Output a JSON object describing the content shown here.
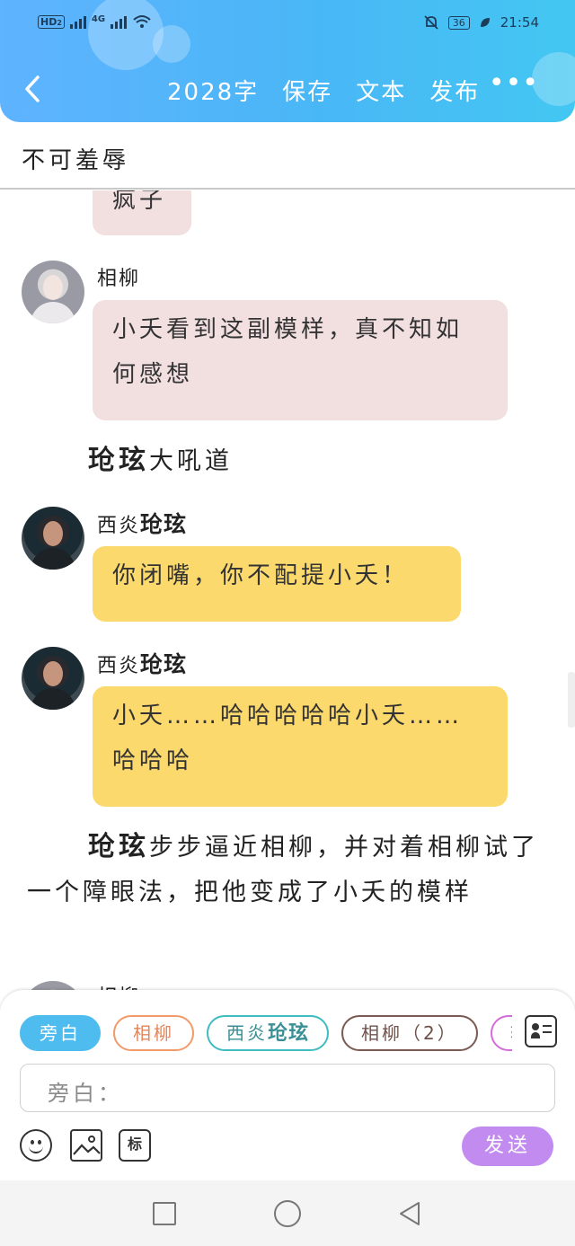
{
  "status_bar": {
    "hd": "HD",
    "hd_sub": "2",
    "network": "4G",
    "battery": "36",
    "time": "21:54"
  },
  "header": {
    "word_count": "2028字",
    "save": "保存",
    "text": "文本",
    "publish": "发布",
    "more": "•••"
  },
  "title": "不可羞辱",
  "chat": {
    "partial_top": "疯子",
    "messages": [
      {
        "speaker": "相柳",
        "text": "小夭看到这副模样，真不知如何感想",
        "color": "pink"
      },
      {
        "narration_bold": "玱玹",
        "narration_rest": "大吼道"
      },
      {
        "speaker_prefix": "西炎",
        "speaker_bold": "玱玹",
        "text": "你闭嘴，你不配提小夭！",
        "color": "yellow"
      },
      {
        "speaker_prefix": "西炎",
        "speaker_bold": "玱玹",
        "text": "小夭……哈哈哈哈哈小夭……哈哈哈",
        "color": "yellow"
      },
      {
        "narration_bold": "玱玹",
        "narration_rest": "步步逼近相柳，并对着相柳试了一个障眼法，把他变成了小夭的模样"
      },
      {
        "speaker": "相柳"
      }
    ]
  },
  "roles": {
    "chips": [
      {
        "label": "旁白"
      },
      {
        "label": "相柳"
      },
      {
        "prefix": "西炎",
        "bold": "玱玹"
      },
      {
        "label": "相柳（2）"
      },
      {
        "label": "轩"
      }
    ]
  },
  "input": {
    "placeholder": "旁白："
  },
  "toolbar": {
    "tag_label": "标",
    "send_label": "发送"
  },
  "colors": {
    "header_blue": "#49b7f6",
    "pink_bubble": "#f2dfe0",
    "yellow_bubble": "#fcd96d",
    "send_purple": "#c18bf0"
  }
}
